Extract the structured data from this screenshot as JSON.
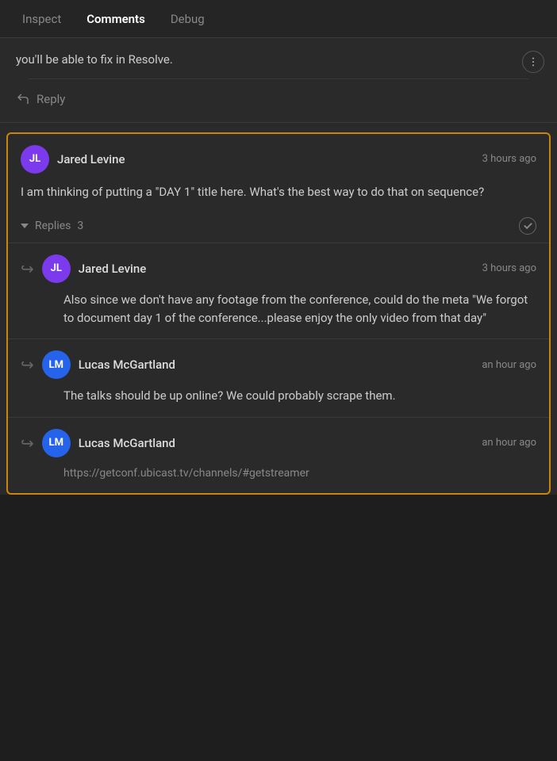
{
  "tabs": [
    {
      "id": "inspect",
      "label": "Inspect",
      "active": false
    },
    {
      "id": "comments",
      "label": "Comments",
      "active": true
    },
    {
      "id": "debug",
      "label": "Debug",
      "active": false
    }
  ],
  "topPartial": {
    "text": "you'll be able to fix in Resolve.",
    "replyLabel": "Reply"
  },
  "mainComment": {
    "author": "Jared Levine",
    "initials": "JL",
    "avatarClass": "avatar-jl",
    "timestamp": "3 hours ago",
    "body": "I am thinking of putting a \"DAY 1\" title here. What's the best way to do that on sequence?",
    "repliesLabel": "Replies",
    "repliesCount": "3",
    "replies": [
      {
        "author": "Jared Levine",
        "initials": "JL",
        "avatarClass": "avatar-jl",
        "timestamp": "3 hours ago",
        "body": "Also since we don't have any footage from the conference, could do the meta \"We forgot to document day 1 of the conference...please enjoy the only video from that day\""
      },
      {
        "author": "Lucas McGartland",
        "initials": "LM",
        "avatarClass": "avatar-lm",
        "timestamp": "an hour ago",
        "body": "The talks should be up online? We could probably scrape them."
      },
      {
        "author": "Lucas McGartland",
        "initials": "LM",
        "avatarClass": "avatar-lm",
        "timestamp": "an hour ago",
        "body": "https://getconf.ubicast.tv/channels/#getstreamer"
      }
    ]
  },
  "icons": {
    "menu": "menu-icon",
    "reply": "reply-icon",
    "chevron": "chevron-down-icon",
    "check": "check-icon",
    "indent": "↪"
  }
}
